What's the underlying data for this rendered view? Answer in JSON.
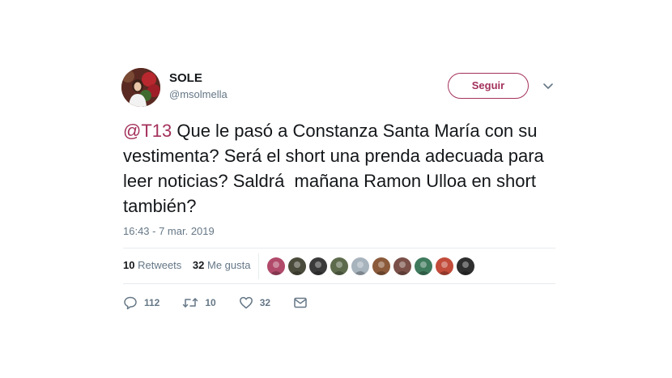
{
  "user": {
    "name": "SOLE",
    "handle": "@msolmella"
  },
  "follow_button": {
    "label": "Seguir"
  },
  "tweet": {
    "mention": "@T13",
    "text": " Que le pasó a Constanza Santa María con su vestimenta? Será el short una prenda adecuada para leer noticias? Saldrá  mañana Ramon Ulloa en short también?",
    "timestamp": "16:43 - 7 mar. 2019"
  },
  "stats": {
    "retweets_count": "10",
    "retweets_label": "Retweets",
    "likes_count": "32",
    "likes_label": "Me gusta"
  },
  "liker_avatars": [
    {
      "color": "#b14a6a"
    },
    {
      "color": "#4b4b3c"
    },
    {
      "color": "#3a3a3a"
    },
    {
      "color": "#5d6b4c"
    },
    {
      "color": "#a7b3bd"
    },
    {
      "color": "#8a5a3a"
    },
    {
      "color": "#7a5048"
    },
    {
      "color": "#3f7a5c"
    },
    {
      "color": "#c24b3a"
    },
    {
      "color": "#2e2e2e"
    }
  ],
  "actions": {
    "reply_count": "112",
    "retweet_count": "10",
    "like_count": "32"
  },
  "colors": {
    "accent": "#a3315c",
    "secondary_text": "#657786",
    "divider": "#e6ecf0"
  }
}
